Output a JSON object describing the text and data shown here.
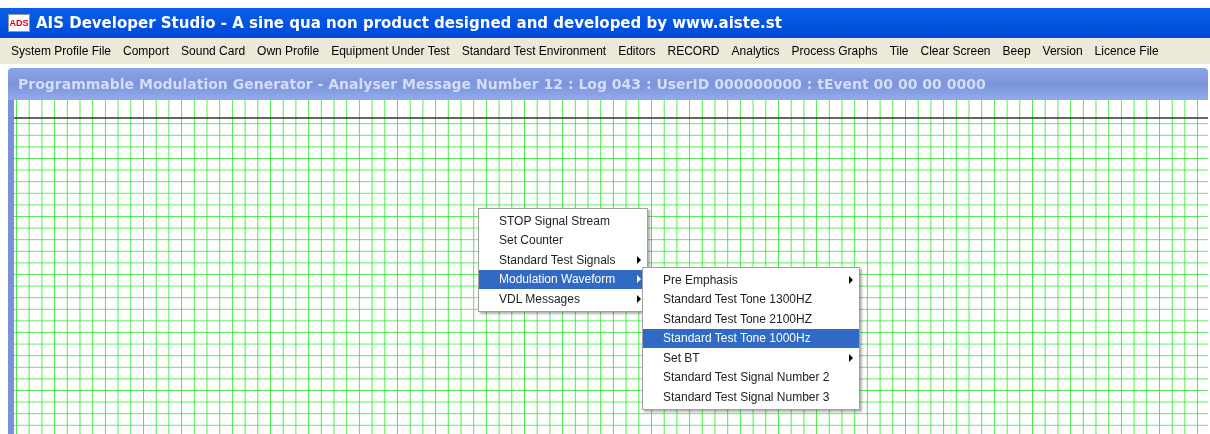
{
  "window": {
    "title": "AIS Developer Studio - A sine qua non product designed and developed by www.aiste.st",
    "icon_text": "ADS"
  },
  "menu_bar": [
    "System Profile File",
    "Comport",
    "Sound Card",
    "Own Profile",
    "Equipment Under Test",
    "Standard Test Environment",
    "Editors",
    "RECORD",
    "Analytics",
    "Process Graphs",
    "Tile",
    "Clear Screen",
    "Beep",
    "Version",
    "Licence File"
  ],
  "child_window": {
    "title": "Programmable Modulation Generator - Analyser Message Number 12 : Log 043 : UserID 000000000 : tEvent 00 00 00 0000"
  },
  "context_menu": [
    {
      "label": "STOP Signal Stream",
      "has_submenu": false,
      "selected": false
    },
    {
      "label": "Set Counter",
      "has_submenu": false,
      "selected": false
    },
    {
      "label": "Standard Test Signals",
      "has_submenu": true,
      "selected": false
    },
    {
      "label": "Modulation Waveform",
      "has_submenu": true,
      "selected": true
    },
    {
      "label": "VDL Messages",
      "has_submenu": true,
      "selected": false
    }
  ],
  "submenu": [
    {
      "label": "Pre Emphasis",
      "has_submenu": true,
      "selected": false
    },
    {
      "label": "Standard Test Tone 1300HZ",
      "has_submenu": false,
      "selected": false
    },
    {
      "label": "Standard Test Tone 2100HZ",
      "has_submenu": false,
      "selected": false
    },
    {
      "label": "Standard Test Tone 1000Hz",
      "has_submenu": false,
      "selected": true
    },
    {
      "label": "Set BT",
      "has_submenu": true,
      "selected": false
    },
    {
      "label": "Standard Test Signal Number 2",
      "has_submenu": false,
      "selected": false
    },
    {
      "label": "Standard Test Signal Number 3",
      "has_submenu": false,
      "selected": false
    }
  ]
}
